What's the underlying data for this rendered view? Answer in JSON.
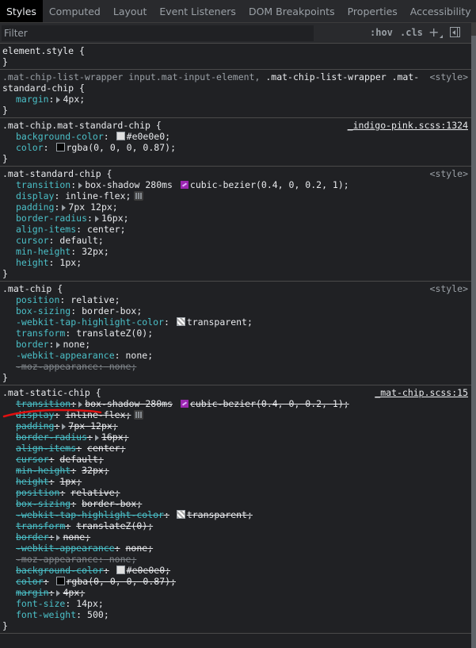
{
  "tabs": [
    "Styles",
    "Computed",
    "Layout",
    "Event Listeners",
    "DOM Breakpoints",
    "Properties",
    "Accessibility"
  ],
  "active_tab": "Styles",
  "filter": {
    "placeholder": "Filter",
    "value": "",
    "hov_label": ":hov",
    "cls_label": ".cls"
  },
  "icons": {
    "new_rule": "plus-icon",
    "toggle_sidebar": "sidebar-toggle-icon",
    "color_swatch": "color-swatch-icon",
    "bezier": "bezier-curve-icon",
    "flexbox": "flexbox-editor-icon",
    "expand": "triangle-right-icon"
  },
  "rules": [
    {
      "selector": "element.style",
      "selector_rest": "",
      "dim": false,
      "source": "",
      "decls": []
    },
    {
      "selector": ".mat-chip-list-wrapper input.mat-input-element,",
      "selector_highlight": " .mat-chip-list-wrapper .mat-",
      "selector_rest": "standard-chip",
      "source": "<style>",
      "decls": [
        {
          "prop": "margin",
          "val": "4px",
          "expand": true
        }
      ]
    },
    {
      "selector": ".mat-chip.mat-standard-chip",
      "source": "_indigo-pink.scss:1324",
      "decls": [
        {
          "prop": "background-color",
          "val": "#e0e0e0",
          "swatch": "#e0e0e0"
        },
        {
          "prop": "color",
          "val": "rgba(0, 0, 0, 0.87)",
          "swatch": "rgba(0,0,0,0.87)"
        }
      ]
    },
    {
      "selector": ".mat-standard-chip",
      "source": "<style>",
      "decls": [
        {
          "prop": "transition",
          "val": "box-shadow 280ms",
          "val2": "cubic-bezier(0.4, 0, 0.2, 1)",
          "expand": true,
          "bezier": true
        },
        {
          "prop": "display",
          "val": "inline-flex",
          "flex": true
        },
        {
          "prop": "padding",
          "val": "7px 12px",
          "expand": true
        },
        {
          "prop": "border-radius",
          "val": "16px",
          "expand": true
        },
        {
          "prop": "align-items",
          "val": "center"
        },
        {
          "prop": "cursor",
          "val": "default"
        },
        {
          "prop": "min-height",
          "val": "32px"
        },
        {
          "prop": "height",
          "val": "1px"
        }
      ]
    },
    {
      "selector": ".mat-chip",
      "source": "<style>",
      "decls": [
        {
          "prop": "position",
          "val": "relative"
        },
        {
          "prop": "box-sizing",
          "val": "border-box"
        },
        {
          "prop": "-webkit-tap-highlight-color",
          "val": "transparent",
          "swatch": "check"
        },
        {
          "prop": "transform",
          "val": "translateZ(0)"
        },
        {
          "prop": "border",
          "val": "none",
          "expand": true
        },
        {
          "prop": "-webkit-appearance",
          "val": "none"
        },
        {
          "prop": "-moz-appearance",
          "val": "none",
          "invalid": true
        }
      ]
    },
    {
      "selector": ".mat-static-chip",
      "source": "_mat-chip.scss:15",
      "decls": [
        {
          "prop": "transition",
          "val": "box-shadow 280ms",
          "val2": "cubic-bezier(0.4, 0, 0.2, 1)",
          "expand": true,
          "bezier": true,
          "over": true
        },
        {
          "prop": "display",
          "val": "inline-flex",
          "flex": true,
          "over": true
        },
        {
          "prop": "padding",
          "val": "7px 12px",
          "expand": true,
          "over": true
        },
        {
          "prop": "border-radius",
          "val": "16px",
          "expand": true,
          "over": true
        },
        {
          "prop": "align-items",
          "val": "center",
          "over": true
        },
        {
          "prop": "cursor",
          "val": "default",
          "over": true
        },
        {
          "prop": "min-height",
          "val": "32px",
          "over": true
        },
        {
          "prop": "height",
          "val": "1px",
          "over": true
        },
        {
          "prop": "position",
          "val": "relative",
          "over": true
        },
        {
          "prop": "box-sizing",
          "val": "border-box",
          "over": true
        },
        {
          "prop": "-webkit-tap-highlight-color",
          "val": "transparent",
          "swatch": "check",
          "over": true
        },
        {
          "prop": "transform",
          "val": "translateZ(0)",
          "over": true
        },
        {
          "prop": "border",
          "val": "none",
          "expand": true,
          "over": true
        },
        {
          "prop": "-webkit-appearance",
          "val": "none",
          "over": true
        },
        {
          "prop": "-moz-appearance",
          "val": "none",
          "invalid": true
        },
        {
          "prop": "background-color",
          "val": "#e0e0e0",
          "swatch": "#e0e0e0",
          "over": true
        },
        {
          "prop": "color",
          "val": "rgba(0, 0, 0, 0.87)",
          "swatch": "rgba(0,0,0,0.87)",
          "over": true
        },
        {
          "prop": "margin",
          "val": "4px",
          "expand": true,
          "over": true
        },
        {
          "prop": "font-size",
          "val": "14px"
        },
        {
          "prop": "font-weight",
          "val": "500"
        }
      ]
    }
  ],
  "annotation": {
    "color": "#e01010",
    "target": ".mat-static-chip"
  }
}
